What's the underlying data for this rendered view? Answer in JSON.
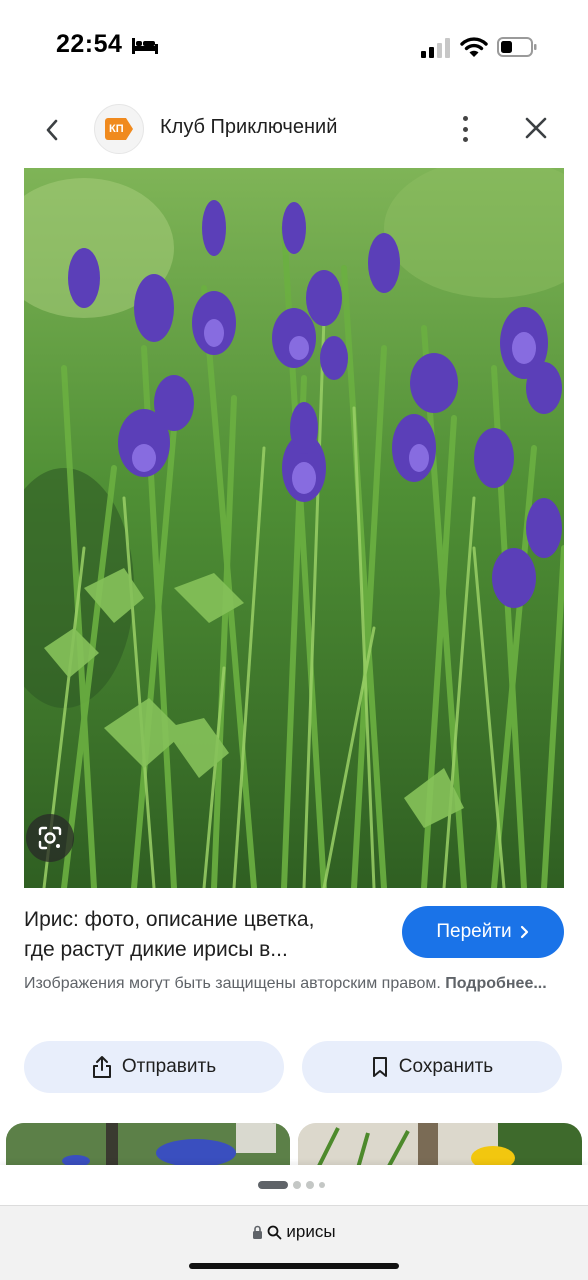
{
  "status_bar": {
    "time": "22:54",
    "icons": [
      "bed-icon",
      "cellular-signal-icon",
      "wifi-icon",
      "battery-icon"
    ]
  },
  "header": {
    "back_icon": "chevron-left-icon",
    "site_logo_text": "КП",
    "site_name": "Клуб Приключений",
    "more_icon": "more-vertical-icon",
    "close_icon": "close-icon"
  },
  "image": {
    "description_icon": "google-lens-icon",
    "colors": {
      "iris": "#5b3fb8",
      "foliage": "#3f7a2c"
    }
  },
  "result": {
    "title_line1": "Ирис: фото, описание цветка,",
    "title_line2": "где растут дикие ирисы в...",
    "visit_label": "Перейти",
    "copyright_text": "Изображения могут быть защищены авторским правом.",
    "more_link": "Подробнее..."
  },
  "actions": {
    "share_label": "Отправить",
    "share_icon": "share-icon",
    "save_label": "Сохранить",
    "save_icon": "bookmark-icon"
  },
  "pager": {
    "pages": 4,
    "active": 0
  },
  "browser": {
    "lock_icon": "lock-icon",
    "search_icon": "search-icon",
    "query": "ирисы"
  },
  "colors": {
    "accent": "#1a73e8",
    "chip_bg": "#e8eefb",
    "text_secondary": "#5f6368"
  }
}
